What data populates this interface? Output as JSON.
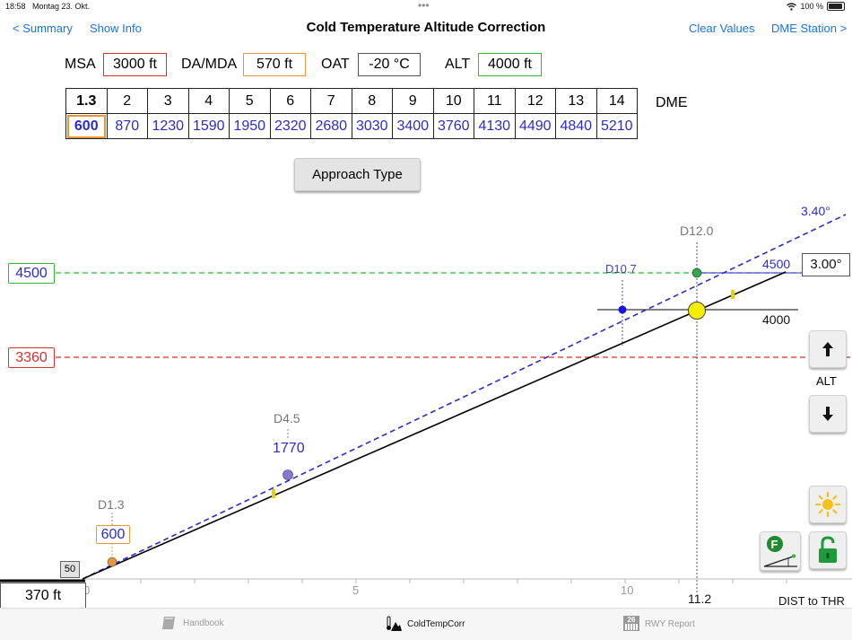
{
  "status_bar": {
    "time": "18:58",
    "date": "Montag 23. Okt.",
    "battery": "100 %"
  },
  "nav": {
    "back_label": "< Summary",
    "info_label": "Show Info",
    "title": "Cold Temperature Altitude Correction",
    "clear_label": "Clear Values",
    "dme_label": "DME Station >"
  },
  "inputs": {
    "msa": {
      "label": "MSA",
      "value": "3000 ft",
      "color": "#d9302c"
    },
    "damda": {
      "label": "DA/MDA",
      "value": "570 ft",
      "color": "#e8953a"
    },
    "oat": {
      "label": "OAT",
      "value": "-20 °C",
      "color": "#555555"
    },
    "alt": {
      "label": "ALT",
      "value": "4000 ft",
      "color": "#2fb92f"
    }
  },
  "dme_table": {
    "dme_label": "DME",
    "distances": [
      "1.3",
      "2",
      "3",
      "4",
      "5",
      "6",
      "7",
      "8",
      "9",
      "10",
      "11",
      "12",
      "13",
      "14"
    ],
    "altitudes": [
      "600",
      "870",
      "1230",
      "1590",
      "1950",
      "2320",
      "2680",
      "3030",
      "3400",
      "3760",
      "4130",
      "4490",
      "4840",
      "5210"
    ]
  },
  "approach_button": "Approach Type",
  "profile": {
    "msa_line_label": "4500",
    "msa_color": "#2fb92f",
    "mda_line_label": "3360",
    "mda_color": "#d9302c",
    "angle_dashed": "3.40°",
    "angle_solid": "3.00°",
    "d12_label": "D12.0",
    "d10_7_label": "D10.7",
    "alt_4500": "4500",
    "alt_4000": "4000",
    "d4_5_label": "D4.5",
    "d4_5_alt": "1770",
    "d1_3_label": "D1.3",
    "d1_3_alt": "600",
    "tch": "50",
    "threshold_alt": "370 ft",
    "x_ticks": [
      "0",
      "5",
      "10"
    ],
    "x_marker": "11.2",
    "x_axis_label": "DIST to THR",
    "alt_label": "ALT"
  },
  "tabs": [
    {
      "label": "Handbook"
    },
    {
      "label": "ColdTempCorr"
    },
    {
      "label": "RWY Report",
      "icon_text": "26"
    }
  ],
  "side_buttons": {
    "f_badge": "F"
  }
}
